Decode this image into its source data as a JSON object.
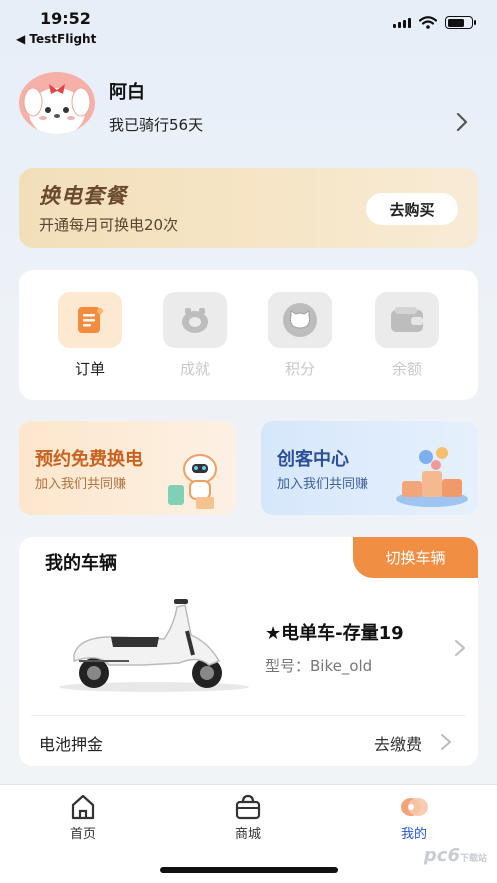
{
  "status_bar": {
    "time": "19:52",
    "back_app": "◀ TestFlight"
  },
  "profile": {
    "name": "阿白",
    "ride_text": "我已骑行56天"
  },
  "package_banner": {
    "title": "换电套餐",
    "subtitle": "开通每月可换电20次",
    "button": "去购买"
  },
  "quick_menu": [
    {
      "label": "订单",
      "icon": "order-icon",
      "active": true
    },
    {
      "label": "成就",
      "icon": "achievement-icon",
      "active": false
    },
    {
      "label": "积分",
      "icon": "points-icon",
      "active": false
    },
    {
      "label": "余额",
      "icon": "wallet-icon",
      "active": false
    }
  ],
  "promos": [
    {
      "title": "预约免费换电",
      "subtitle": "加入我们共同赚"
    },
    {
      "title": "创客中心",
      "subtitle": "加入我们共同赚"
    }
  ],
  "vehicle": {
    "section_title": "我的车辆",
    "switch_button": "切换车辆",
    "name": "★电单车-存量19",
    "model": "型号：Bike_old",
    "deposit_label": "电池押金",
    "deposit_action": "去缴费"
  },
  "tabbar": [
    {
      "label": "首页",
      "icon": "home-icon",
      "active": false
    },
    {
      "label": "商城",
      "icon": "shop-bag-icon",
      "active": false
    },
    {
      "label": "我的",
      "icon": "profile-icon",
      "active": true
    }
  ],
  "watermark": "pc6",
  "watermark_small": "下载站",
  "colors": {
    "accent_orange": "#f08e43",
    "active_blue": "#2458d8",
    "promo_left_title": "#c9621f",
    "promo_right_title": "#2c4f9a"
  }
}
